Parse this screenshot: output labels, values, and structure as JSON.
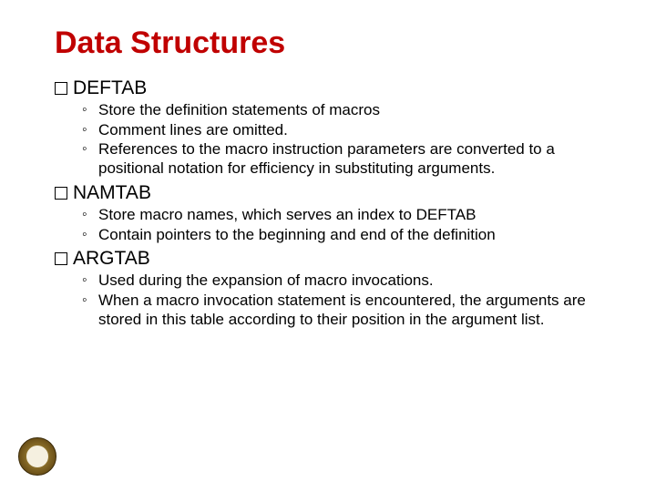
{
  "title": "Data Structures",
  "sections": [
    {
      "name": "DEFTAB",
      "items": [
        "Store the definition statements of macros",
        "Comment lines are omitted.",
        "References to the macro instruction parameters are converted to a positional notation for efficiency in substituting arguments."
      ]
    },
    {
      "name": "NAMTAB",
      "items": [
        "Store macro names, which serves an index to DEFTAB",
        "Contain pointers to the beginning and end of the definition"
      ]
    },
    {
      "name": "ARGTAB",
      "items": [
        "Used during the expansion of macro invocations.",
        "When a macro invocation statement is encountered, the arguments are stored in this table according to their position in the argument list."
      ]
    }
  ],
  "logo_label": "emblem"
}
